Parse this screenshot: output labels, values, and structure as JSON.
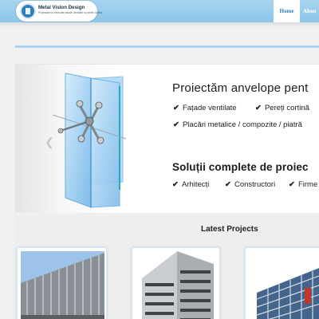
{
  "header": {
    "logo_title": "Metal Vision Design",
    "logo_tagline": "Proiectare si executie fatade ventilate si pereti cortina",
    "nav": {
      "home": "Home",
      "about": "Abou"
    }
  },
  "slider": {
    "headline_1": "Proiectăm anvelope pent",
    "features_1": [
      "Fațade ventilate",
      "Pereți cortină",
      "Placări metalice / compozite / piatră"
    ],
    "headline_2": "Soluții complete de proiec",
    "audience": [
      "Arhitecți",
      "Constructori",
      "Firme"
    ],
    "check_icon": "✔",
    "prev_icon": "❮"
  },
  "projects": {
    "title": "Latest Projects",
    "items": [
      {
        "name": "project-1",
        "accent": "#8a94a0"
      },
      {
        "name": "project-2",
        "accent": "#b9c0c6"
      },
      {
        "name": "project-3",
        "accent": "#4d6f95"
      }
    ]
  },
  "colors": {
    "topbar": "#9ccdec",
    "nav_active": "#2f7fbf",
    "rule": "#a9d3f0"
  }
}
